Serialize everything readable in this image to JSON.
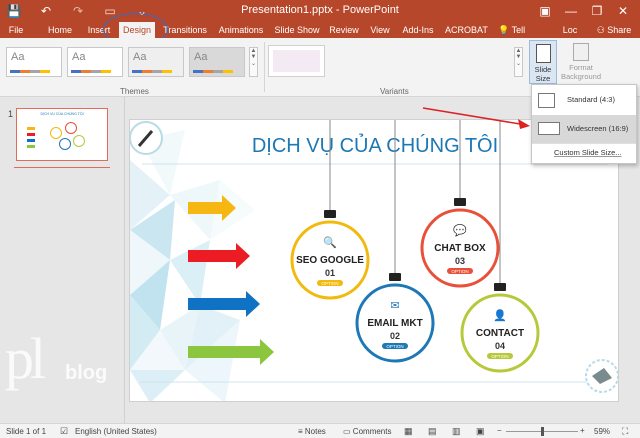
{
  "window": {
    "title": "Presentation1.pptx - PowerPoint",
    "controls": {
      "minimize": "—",
      "restore": "❐",
      "close": "✕",
      "ribbon_options": "▣"
    }
  },
  "quick_access": {
    "save_icon": "💾",
    "undo_icon": "↶",
    "redo_icon": "↷",
    "customize_icon": "⌄"
  },
  "tabs": [
    "File",
    "Home",
    "Insert",
    "Design",
    "Transitions",
    "Animations",
    "Slide Show",
    "Review",
    "View",
    "Add-Ins",
    "ACROBAT"
  ],
  "active_tab": "Design",
  "tell_me": "Tell me...",
  "user": "Loc Pham",
  "share": "Share",
  "ribbon": {
    "themes_label": "Themes",
    "variants_label": "Variants",
    "theme_sample": "Aa",
    "slide_size": "Slide Size",
    "format_background": "Format Background"
  },
  "slide_size_menu": {
    "items": [
      "Standard (4:3)",
      "Widescreen (16:9)"
    ],
    "custom": "Custom Slide Size..."
  },
  "thumbnails": [
    {
      "number": "1",
      "title": "DỊCH VỤ CỦA CHÚNG TÔI"
    }
  ],
  "slide": {
    "title": "DỊCH VỤ CỦA CHÚNG TÔI",
    "services": [
      {
        "name": "SEO GOOGLE",
        "num": "01",
        "tag": "OPTION",
        "color": "#f2b90f"
      },
      {
        "name": "CHAT BOX",
        "num": "03",
        "tag": "OPTION",
        "color": "#e8503a"
      },
      {
        "name": "EMAIL MKT",
        "num": "02",
        "tag": "OPTION",
        "color": "#1d78b5"
      },
      {
        "name": "CONTACT",
        "num": "04",
        "tag": "OPTION",
        "color": "#b6c93a"
      }
    ],
    "arrow_colors": [
      "#f7b713",
      "#ec1c24",
      "#0f72c5",
      "#8cc63f"
    ]
  },
  "watermark": {
    "text": "pl blog"
  },
  "status": {
    "slide": "Slide 1 of 1",
    "language": "English (United States)",
    "notes": "Notes",
    "comments": "Comments",
    "zoom": "59%"
  }
}
